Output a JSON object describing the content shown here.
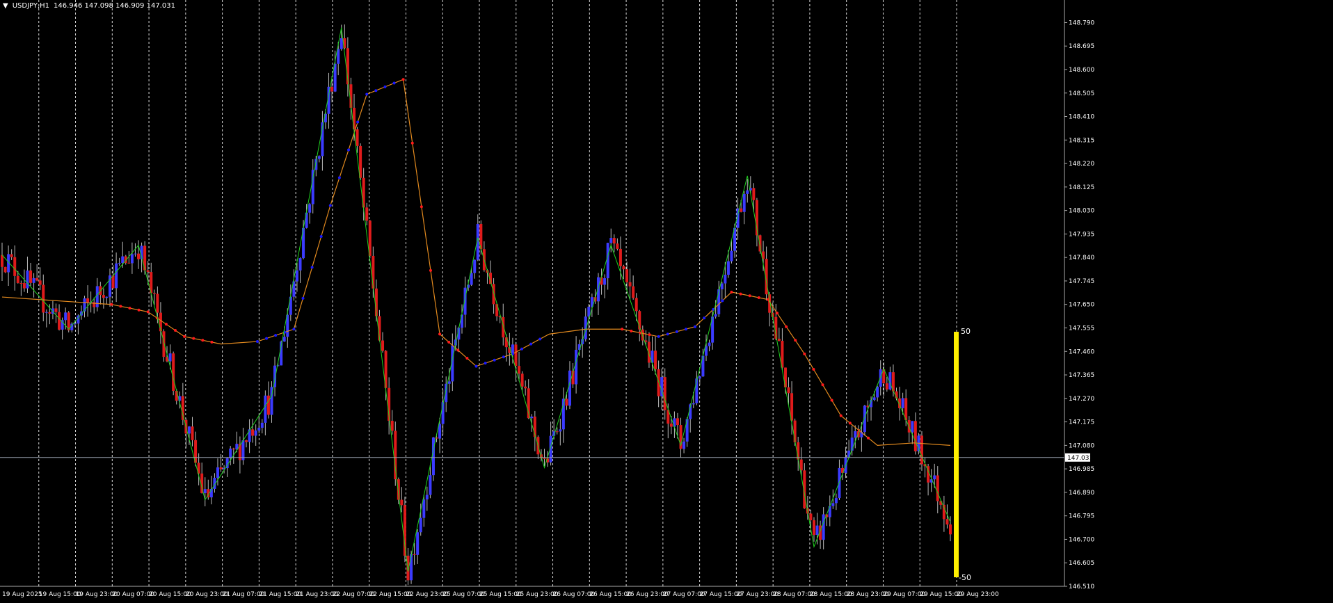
{
  "header": {
    "symbol": "USDJPY,H1",
    "ohlc": "146.946 147.098 146.909 147.031",
    "menu_icon": "triangle-down-icon"
  },
  "colors": {
    "background": "#000000",
    "bull_candle": "#3b3bff",
    "bear_candle": "#e01b1b",
    "zigzag": "#1fd21f",
    "ma_line": "#e38a1e",
    "dots_up": "#1a1aff",
    "dots_down": "#ff1a1a",
    "grid": "#ffffff",
    "axis_text": "#ffffff",
    "price_line": "#9aa3b0",
    "oscillator_bar": "#ffee00"
  },
  "chart_data": {
    "type": "candlestick",
    "title": "USDJPY,H1",
    "ylim": [
      146.51,
      148.87
    ],
    "y_ticks": [
      "148.790",
      "148.695",
      "148.600",
      "148.505",
      "148.410",
      "148.315",
      "148.220",
      "148.125",
      "148.030",
      "147.935",
      "147.840",
      "147.745",
      "147.650",
      "147.555",
      "147.460",
      "147.365",
      "147.270",
      "147.175",
      "147.080",
      "146.985",
      "146.890",
      "146.795",
      "146.700",
      "146.605",
      "146.510"
    ],
    "x_ticks": [
      "19 Aug 2025",
      "19 Aug 15:00",
      "19 Aug 23:00",
      "20 Aug 07:00",
      "20 Aug 15:00",
      "20 Aug 23:00",
      "21 Aug 07:00",
      "21 Aug 15:00",
      "21 Aug 23:00",
      "22 Aug 07:00",
      "22 Aug 15:00",
      "22 Aug 23:00",
      "25 Aug 07:00",
      "25 Aug 15:00",
      "25 Aug 23:00",
      "26 Aug 07:00",
      "26 Aug 15:00",
      "26 Aug 23:00",
      "27 Aug 07:00",
      "27 Aug 15:00",
      "27 Aug 23:00",
      "28 Aug 07:00",
      "28 Aug 15:00",
      "28 Aug 23:00",
      "29 Aug 07:00",
      "29 Aug 15:00",
      "29 Aug 23:00"
    ],
    "current_price": "147.031",
    "zigzag": [
      147.85,
      147.55,
      147.89,
      146.86,
      147.28,
      148.77,
      146.57,
      147.92,
      146.99,
      147.89,
      147.08,
      148.17,
      146.67,
      147.39,
      146.77
    ],
    "ma_line": [
      147.68,
      147.67,
      147.66,
      147.65,
      147.62,
      147.52,
      147.49,
      147.5,
      147.55,
      148.05,
      148.5,
      148.56,
      147.53,
      147.4,
      147.45,
      147.53,
      147.55,
      147.55,
      147.52,
      147.56,
      147.7,
      147.67,
      147.45,
      147.2,
      147.08,
      147.09,
      147.08
    ],
    "oscillator": {
      "max_label": "50",
      "min_label": "-50",
      "value": 50
    },
    "grid": "vertical-dashed",
    "legend": "none"
  }
}
